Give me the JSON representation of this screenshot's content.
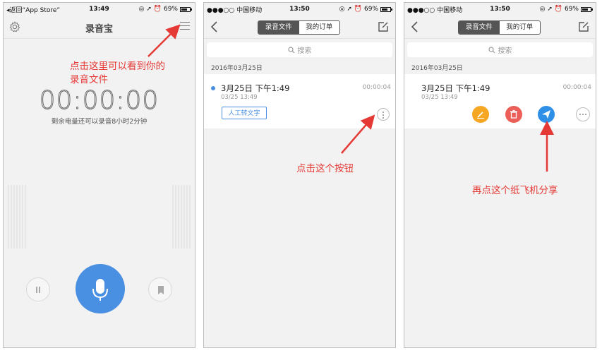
{
  "phone1": {
    "status": {
      "carrier": "◂返回“App Store”",
      "time": "13:49",
      "battery": "69%"
    },
    "title": "录音宝",
    "timer": "00:00:00",
    "remaining": "剩余电量还可以录音8小时2分钟"
  },
  "phone2": {
    "status": {
      "carrier": "●●●○○ 中国移动",
      "time": "13:50",
      "battery": "69%"
    },
    "tabs": [
      "录音文件",
      "我的订单"
    ],
    "search_placeholder": "搜索",
    "date_header": "2016年03月25日",
    "record": {
      "title": "3月25日 下午1:49",
      "subtitle": "03/25 13:49",
      "duration": "00:00:04",
      "transcribe_label": "人工转文字"
    }
  },
  "phone3": {
    "status": {
      "carrier": "●●●○○ 中国移动",
      "time": "13:50",
      "battery": "69%"
    },
    "tabs": [
      "录音文件",
      "我的订单"
    ],
    "search_placeholder": "搜索",
    "date_header": "2016年03月25日",
    "record": {
      "title": "3月25日 下午1:49",
      "subtitle": "03/25 13:49",
      "duration": "00:00:04"
    },
    "actions": [
      "edit-icon",
      "trash-icon",
      "paper-plane-icon",
      "more-icon"
    ]
  },
  "annotations": {
    "a1_line1": "点击这里可以看到你的",
    "a1_line2": "录音文件",
    "a2": "点击这个按钮",
    "a3": "再点这个纸飞机分享"
  },
  "colors": {
    "accent": "#4a90e2",
    "annotation": "#e53935",
    "edit": "#f5a623",
    "delete": "#ec5f59",
    "share": "#2e8fe6"
  }
}
